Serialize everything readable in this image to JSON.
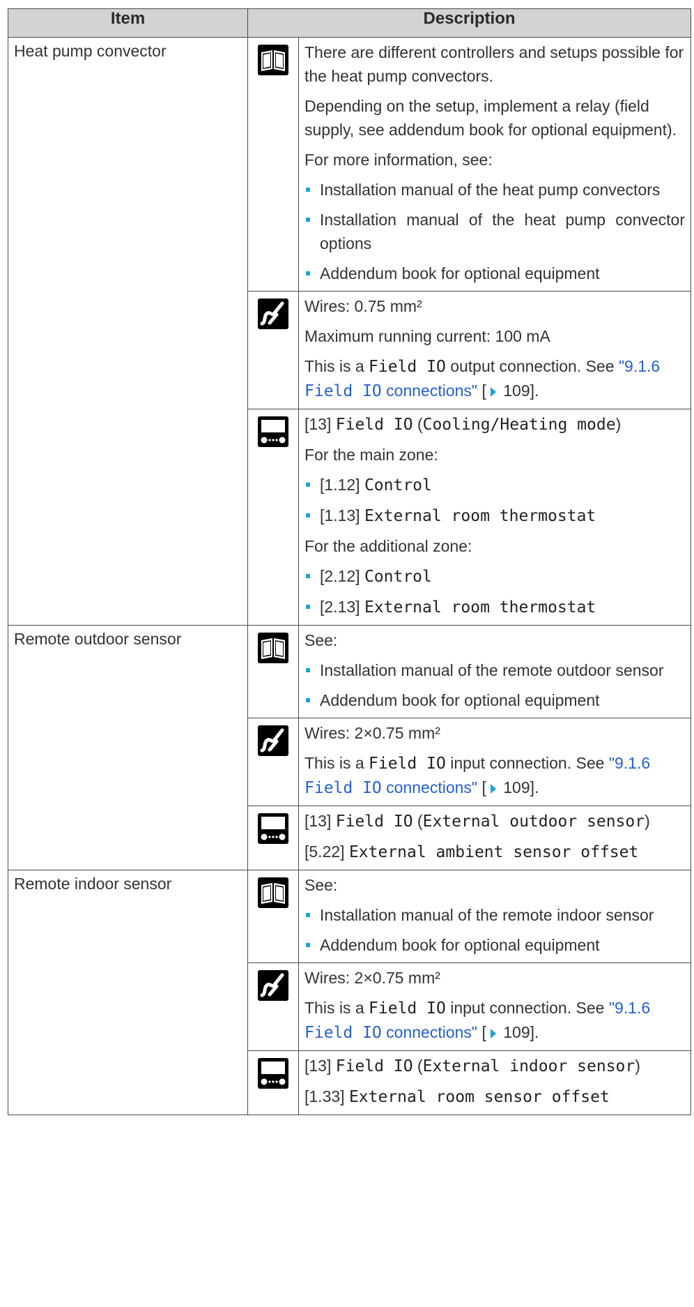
{
  "header": {
    "item": "Item",
    "description": "Description"
  },
  "rows": [
    {
      "item": "Heat pump convector",
      "book": {
        "p1": "There are different controllers and setups possible for the heat pump convectors.",
        "p2": "Depending on the setup, implement a relay (field supply, see addendum book for optional equipment).",
        "p3": "For more information, see:",
        "b1": "Installation manual of the heat pump convectors",
        "b2": "Installation manual of the heat pump convector options",
        "b3": "Addendum book for optional equipment"
      },
      "wire": {
        "p1": "Wires: 0.75 mm²",
        "p2": "Maximum running current: 100 mA",
        "pre": "This is a ",
        "code": "Field IO",
        "post": " output connection. See ",
        "link_q": "\"9.1.6 ",
        "link_code": "Field IO",
        "link_rest": " connections\"",
        "ref_open": " [",
        "ref_page": " 109",
        "ref_close": "]."
      },
      "remote": {
        "l1_num": "[13] ",
        "l1_code": "Field IO",
        "l1_paren_open": " (",
        "l1_code2": "Cooling/Heating mode",
        "l1_paren_close": ")",
        "main": "For the main zone:",
        "mb1_num": "[1.12] ",
        "mb1_code": "Control",
        "mb2_num": "[1.13] ",
        "mb2_code": "External room thermostat",
        "add": "For the additional zone:",
        "ab1_num": "[2.12] ",
        "ab1_code": "Control",
        "ab2_num": "[2.13] ",
        "ab2_code": "External room thermostat"
      }
    },
    {
      "item": "Remote outdoor sensor",
      "book": {
        "p1": "See:",
        "b1": "Installation manual of the remote outdoor sensor",
        "b2": "Addendum book for optional equipment"
      },
      "wire": {
        "p1": "Wires: 2×0.75 mm²",
        "pre": "This is a ",
        "code": "Field IO",
        "post": " input connection. See ",
        "link_q": "\"9.1.6 ",
        "link_code": "Field IO",
        "link_rest": " connections\"",
        "ref_open": " [",
        "ref_page": " 109",
        "ref_close": "]."
      },
      "remote": {
        "l1_num": "[13] ",
        "l1_code": "Field IO",
        "l1_paren_open": " (",
        "l1_code2": "External outdoor sensor",
        "l1_paren_close": ")",
        "l2_num": "[5.22] ",
        "l2_code": "External ambient sensor offset"
      }
    },
    {
      "item": "Remote indoor sensor",
      "book": {
        "p1": "See:",
        "b1": "Installation manual of the remote indoor sensor",
        "b2": "Addendum book for optional equipment"
      },
      "wire": {
        "p1": "Wires: 2×0.75 mm²",
        "pre": "This is a ",
        "code": "Field IO",
        "post": " input connection. See ",
        "link_q": "\"9.1.6 ",
        "link_code": "Field IO",
        "link_rest": " connections\"",
        "ref_open": " [",
        "ref_page": " 109",
        "ref_close": "]."
      },
      "remote": {
        "l1_num": "[13] ",
        "l1_code": "Field IO",
        "l1_paren_open": " (",
        "l1_code2": "External indoor sensor",
        "l1_paren_close": ")",
        "l2_num": "[1.33] ",
        "l2_code": "External room sensor offset"
      }
    }
  ]
}
